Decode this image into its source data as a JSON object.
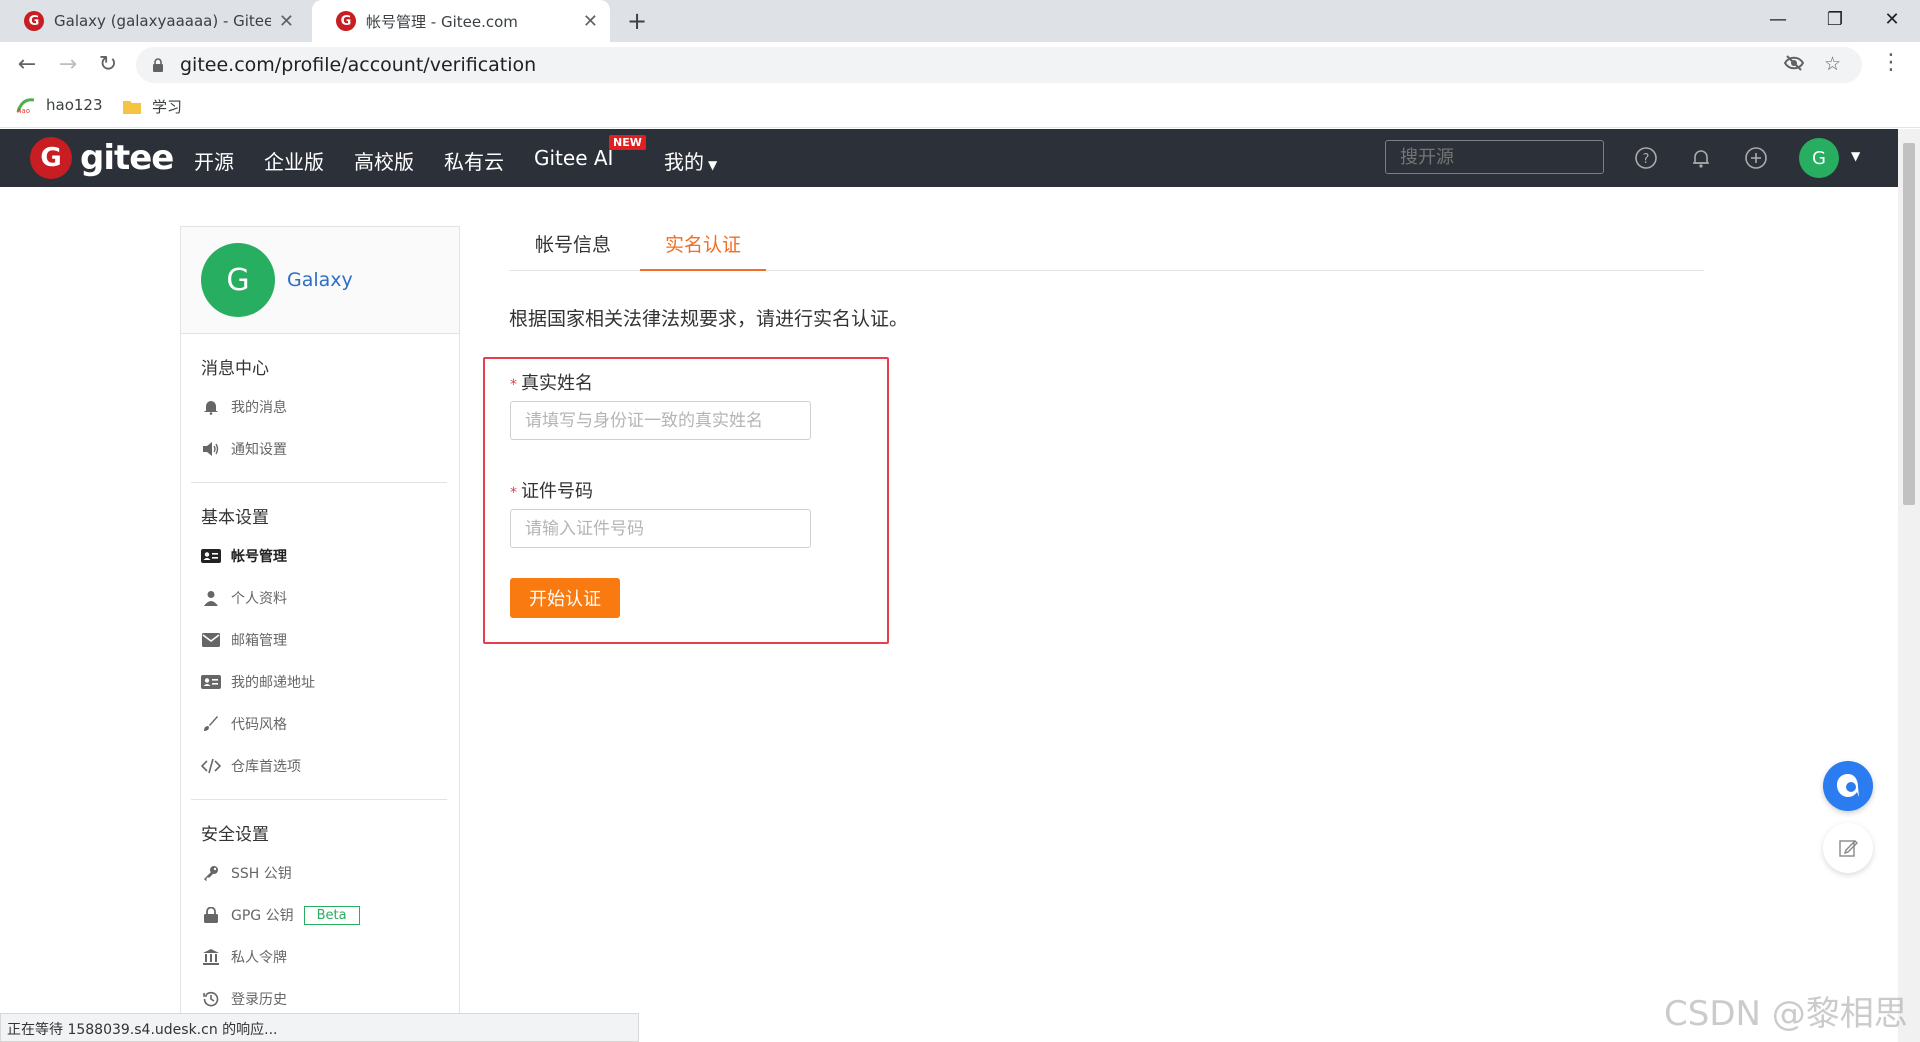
{
  "browser": {
    "tabs": [
      {
        "title": "Galaxy (galaxyaaaaa) - Gitee.co",
        "favicon": "gitee-favicon"
      },
      {
        "title": "帐号管理 - Gitee.com",
        "favicon": "gitee-favicon"
      }
    ],
    "url": "gitee.com/profile/account/verification",
    "bookmarks": [
      {
        "label": "hao123"
      },
      {
        "label": "学习"
      }
    ]
  },
  "header": {
    "logo_letter": "G",
    "logo_text": "gitee",
    "nav": [
      "开源",
      "企业版",
      "高校版",
      "私有云",
      "Gitee AI",
      "我的"
    ],
    "new_badge": "NEW",
    "search_placeholder": "搜开源",
    "avatar_letter": "G"
  },
  "sidebar": {
    "user": {
      "avatar_letter": "G",
      "name": "Galaxy"
    },
    "groups": [
      {
        "title": "消息中心",
        "items": [
          {
            "label": "我的消息",
            "icon": "bell-icon"
          },
          {
            "label": "通知设置",
            "icon": "speaker-icon"
          }
        ]
      },
      {
        "title": "基本设置",
        "items": [
          {
            "label": "帐号管理",
            "icon": "id-card-icon",
            "active": true
          },
          {
            "label": "个人资料",
            "icon": "user-icon"
          },
          {
            "label": "邮箱管理",
            "icon": "envelope-icon"
          },
          {
            "label": "我的邮递地址",
            "icon": "address-card-icon"
          },
          {
            "label": "代码风格",
            "icon": "brush-icon"
          },
          {
            "label": "仓库首选项",
            "icon": "code-icon"
          }
        ]
      },
      {
        "title": "安全设置",
        "items": [
          {
            "label": "SSH 公钥",
            "icon": "key-icon"
          },
          {
            "label": "GPG 公钥",
            "icon": "lock-icon",
            "badge": "Beta"
          },
          {
            "label": "私人令牌",
            "icon": "token-icon"
          },
          {
            "label": "登录历史",
            "icon": "history-icon"
          }
        ]
      }
    ]
  },
  "main": {
    "tabs": [
      {
        "label": "帐号信息",
        "active": false
      },
      {
        "label": "实名认证",
        "active": true
      }
    ],
    "notice": "根据国家相关法律法规要求，请进行实名认证。",
    "form": {
      "name_label": "真实姓名",
      "name_placeholder": "请填写与身份证一致的真实姓名",
      "id_label": "证件号码",
      "id_placeholder": "请输入证件号码",
      "required_mark": "*",
      "submit_label": "开始认证"
    }
  },
  "status_text": "正在等待 1588039.s4.udesk.cn 的响应...",
  "watermark": "CSDN @黎相思",
  "colors": {
    "accent": "#f36d24",
    "button": "#fa7a12",
    "header_bg": "#2c3038",
    "brand_red": "#c71d23",
    "avatar_green": "#27ae60",
    "highlight_border": "#e63e4c"
  }
}
